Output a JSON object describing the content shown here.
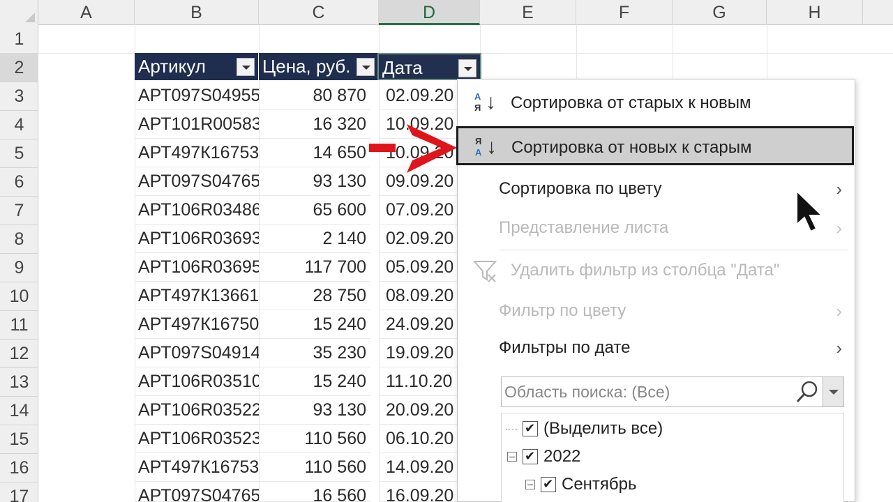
{
  "columns": [
    "A",
    "B",
    "C",
    "D",
    "E",
    "F",
    "G",
    "H"
  ],
  "rows": [
    "1",
    "2",
    "3",
    "4",
    "5",
    "6",
    "7",
    "8",
    "9",
    "10",
    "11",
    "12",
    "13",
    "14",
    "15",
    "16",
    "17"
  ],
  "table": {
    "headers": {
      "article": "Артикул",
      "price": "Цена, руб.",
      "date": "Дата"
    },
    "rows": [
      {
        "article": "АРТ097S04955",
        "price": "80 870",
        "date": "02.09.20"
      },
      {
        "article": "АРТ101R00583",
        "price": "16 320",
        "date": "10.09.20"
      },
      {
        "article": "АРТ497К16753",
        "price": "14 650",
        "date": "10.09.20"
      },
      {
        "article": "АРТ097S04765",
        "price": "93 130",
        "date": "09.09.20"
      },
      {
        "article": "АРТ106R03486",
        "price": "65 600",
        "date": "07.09.20"
      },
      {
        "article": "АРТ106R03693",
        "price": "2 140",
        "date": "02.09.20"
      },
      {
        "article": "АРТ106R03695",
        "price": "117 700",
        "date": "05.09.20"
      },
      {
        "article": "АРТ497К13661",
        "price": "28 750",
        "date": "08.09.20"
      },
      {
        "article": "АРТ497К16750",
        "price": "15 240",
        "date": "24.09.20"
      },
      {
        "article": "АРТ097S04914",
        "price": "35 230",
        "date": "19.09.20"
      },
      {
        "article": "АРТ106R03510",
        "price": "15 240",
        "date": "11.10.20"
      },
      {
        "article": "АРТ106R03522",
        "price": "93 130",
        "date": "20.09.20"
      },
      {
        "article": "АРТ106R03523",
        "price": "110 560",
        "date": "06.10.20"
      },
      {
        "article": "АРТ497К16753",
        "price": "110 560",
        "date": "14.09.20"
      },
      {
        "article": "АРТ097S04765",
        "price": "16 560",
        "date": "16.09.20"
      }
    ]
  },
  "menu": {
    "sort_old_new": "Сортировка от старых к новым",
    "sort_new_old": "Сортировка от новых к старым",
    "sort_by_color": "Сортировка по цвету",
    "sheet_view": "Представление листа",
    "clear_filter": "Удалить фильтр из столбца \"Дата\"",
    "filter_by_color": "Фильтр по цвету",
    "date_filters": "Фильтры по дате",
    "search_placeholder": "Область поиска: (Все)",
    "tree": {
      "select_all": "(Выделить все)",
      "year": "2022",
      "month": "Сентябрь"
    },
    "chevron": "›",
    "icon_letters": {
      "a": "А",
      "ya": "Я"
    }
  },
  "colors": {
    "table_header": "#1f2d4f",
    "highlight": "#cfcfcf",
    "annotation": "#e0151c",
    "sort_a_blue": "#2f6fc4"
  }
}
